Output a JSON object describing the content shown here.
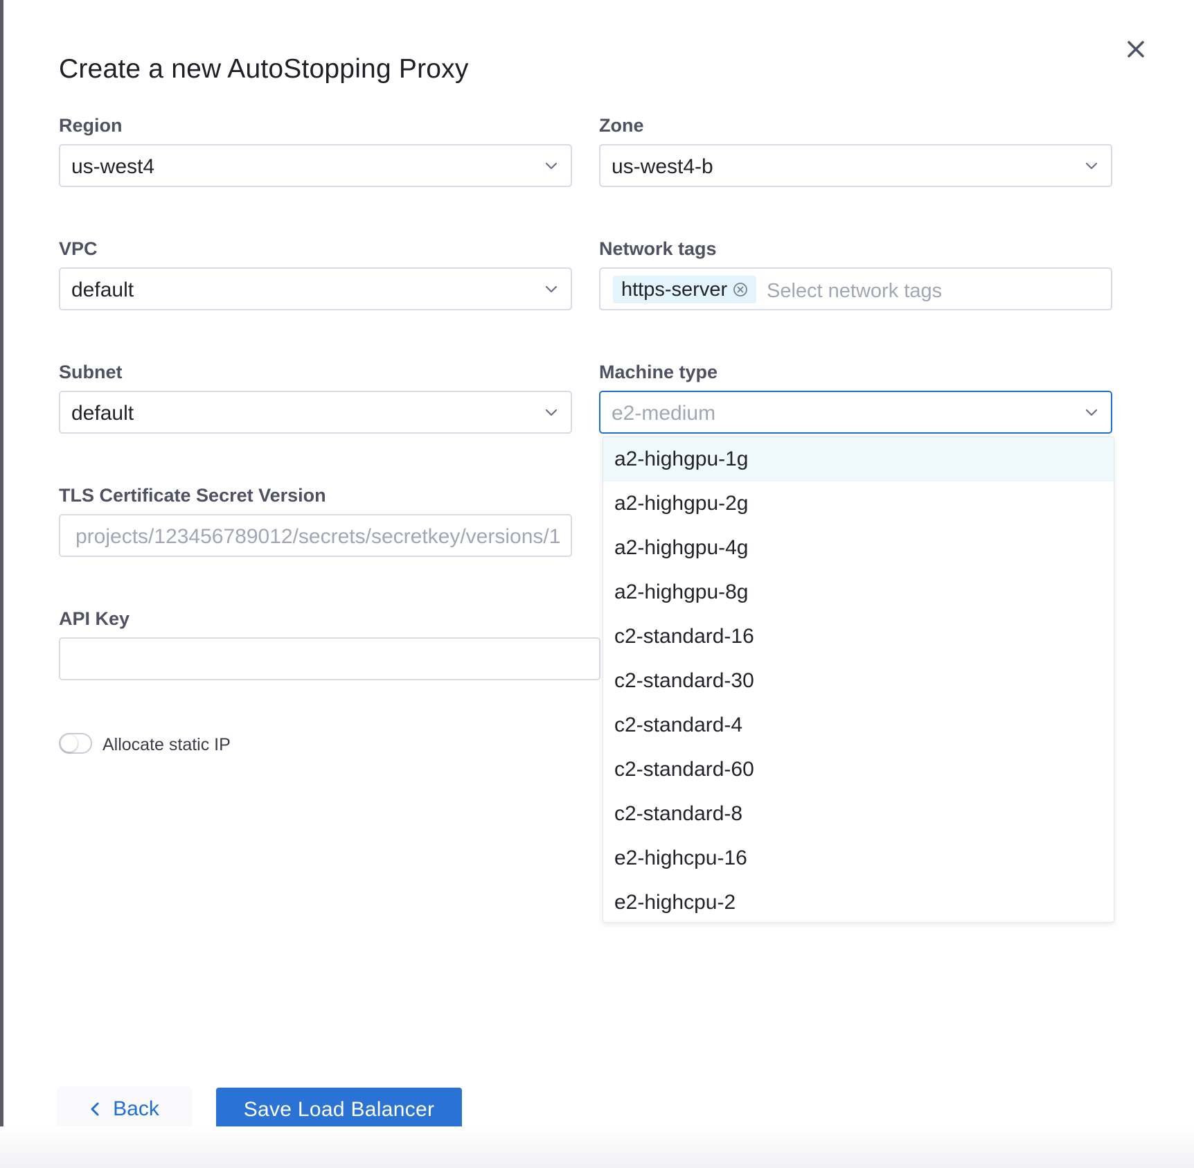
{
  "dialog": {
    "title": "Create a new AutoStopping Proxy",
    "close_icon": "close-icon"
  },
  "region": {
    "label": "Region",
    "value": "us-west4"
  },
  "zone": {
    "label": "Zone",
    "value": "us-west4-b"
  },
  "vpc": {
    "label": "VPC",
    "value": "default"
  },
  "network_tags": {
    "label": "Network tags",
    "tags": [
      "https-server"
    ],
    "placeholder": "Select network tags"
  },
  "subnet": {
    "label": "Subnet",
    "value": "default"
  },
  "machine_type": {
    "label": "Machine type",
    "placeholder": "e2-medium",
    "options": [
      "a2-highgpu-1g",
      "a2-highgpu-2g",
      "a2-highgpu-4g",
      "a2-highgpu-8g",
      "c2-standard-16",
      "c2-standard-30",
      "c2-standard-4",
      "c2-standard-60",
      "c2-standard-8",
      "e2-highcpu-16",
      "e2-highcpu-2"
    ],
    "highlighted_option": "a2-highgpu-1g"
  },
  "tls": {
    "label": "TLS Certificate Secret Version",
    "placeholder": "projects/123456789012/secrets/secretkey/versions/1"
  },
  "api_key": {
    "label": "API Key",
    "value": ""
  },
  "static_ip": {
    "label": "Allocate static IP",
    "enabled": false
  },
  "buttons": {
    "back": "Back",
    "save": "Save Load Balancer"
  },
  "colors": {
    "primary": "#2a72d4",
    "focus_border": "#1e6fd1",
    "tag_bg": "#e4f4fb",
    "option_highlight": "#eff8fb"
  }
}
